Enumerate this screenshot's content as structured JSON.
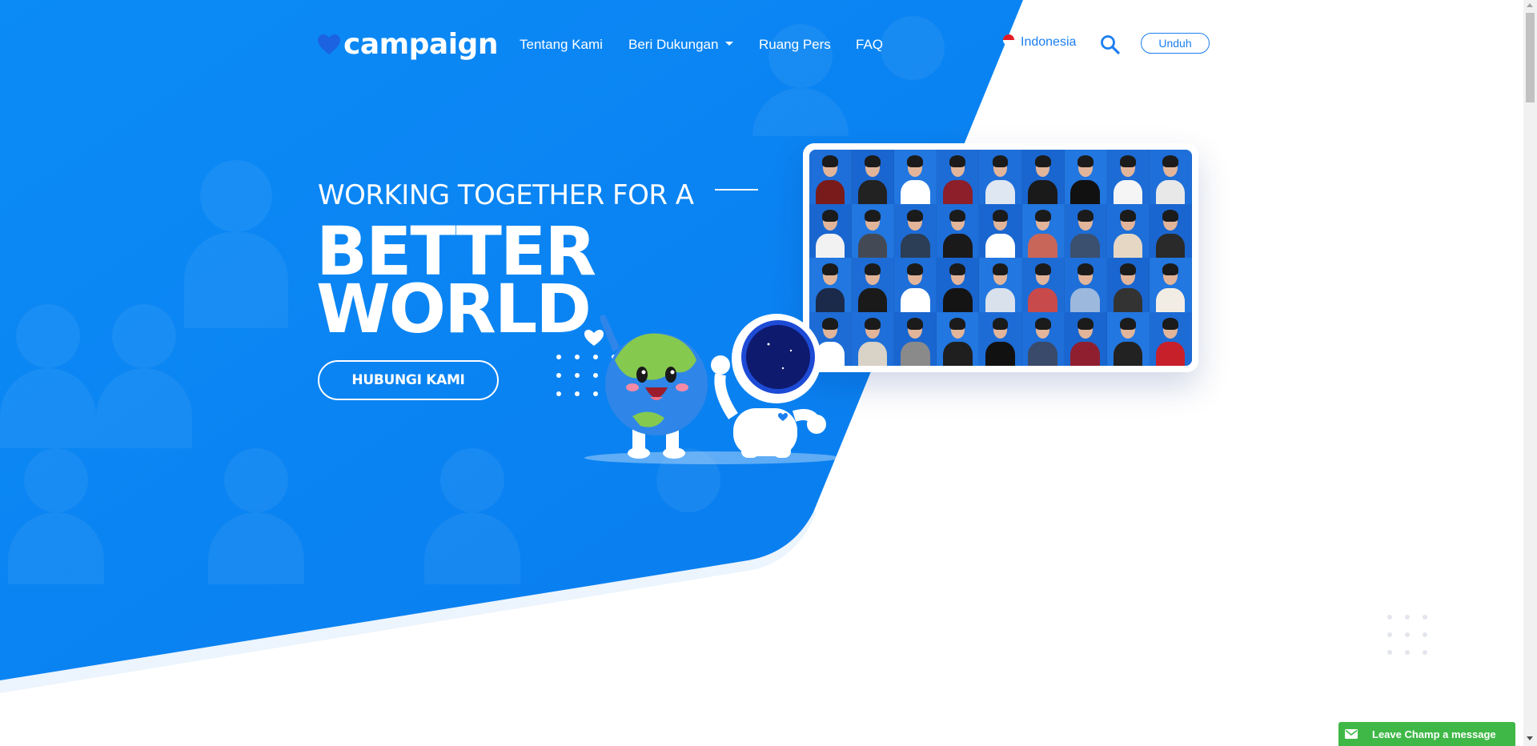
{
  "colors": {
    "brand_blue": "#0a86f2",
    "link_blue": "#1b7ef0",
    "chat_green": "#3fb847"
  },
  "header": {
    "logo_text": "campaign",
    "logo_icon": "heart-icon",
    "nav": [
      {
        "label": "Tentang Kami"
      },
      {
        "label": "Beri Dukungan",
        "has_dropdown": true
      },
      {
        "label": "Ruang Pers"
      },
      {
        "label": "FAQ"
      }
    ],
    "language": "Indonesia",
    "language_icon": "indonesia-flag-icon",
    "search_icon": "search-icon",
    "download_label": "Unduh"
  },
  "hero": {
    "pre_title": "WORKING TOGETHER FOR A",
    "title_line1": "BETTER",
    "title_line2": "WORLD",
    "cta_label": "HUBUNGI KAMI"
  },
  "chat_widget": {
    "label": "Leave Champ a message",
    "icon": "envelope-icon"
  }
}
